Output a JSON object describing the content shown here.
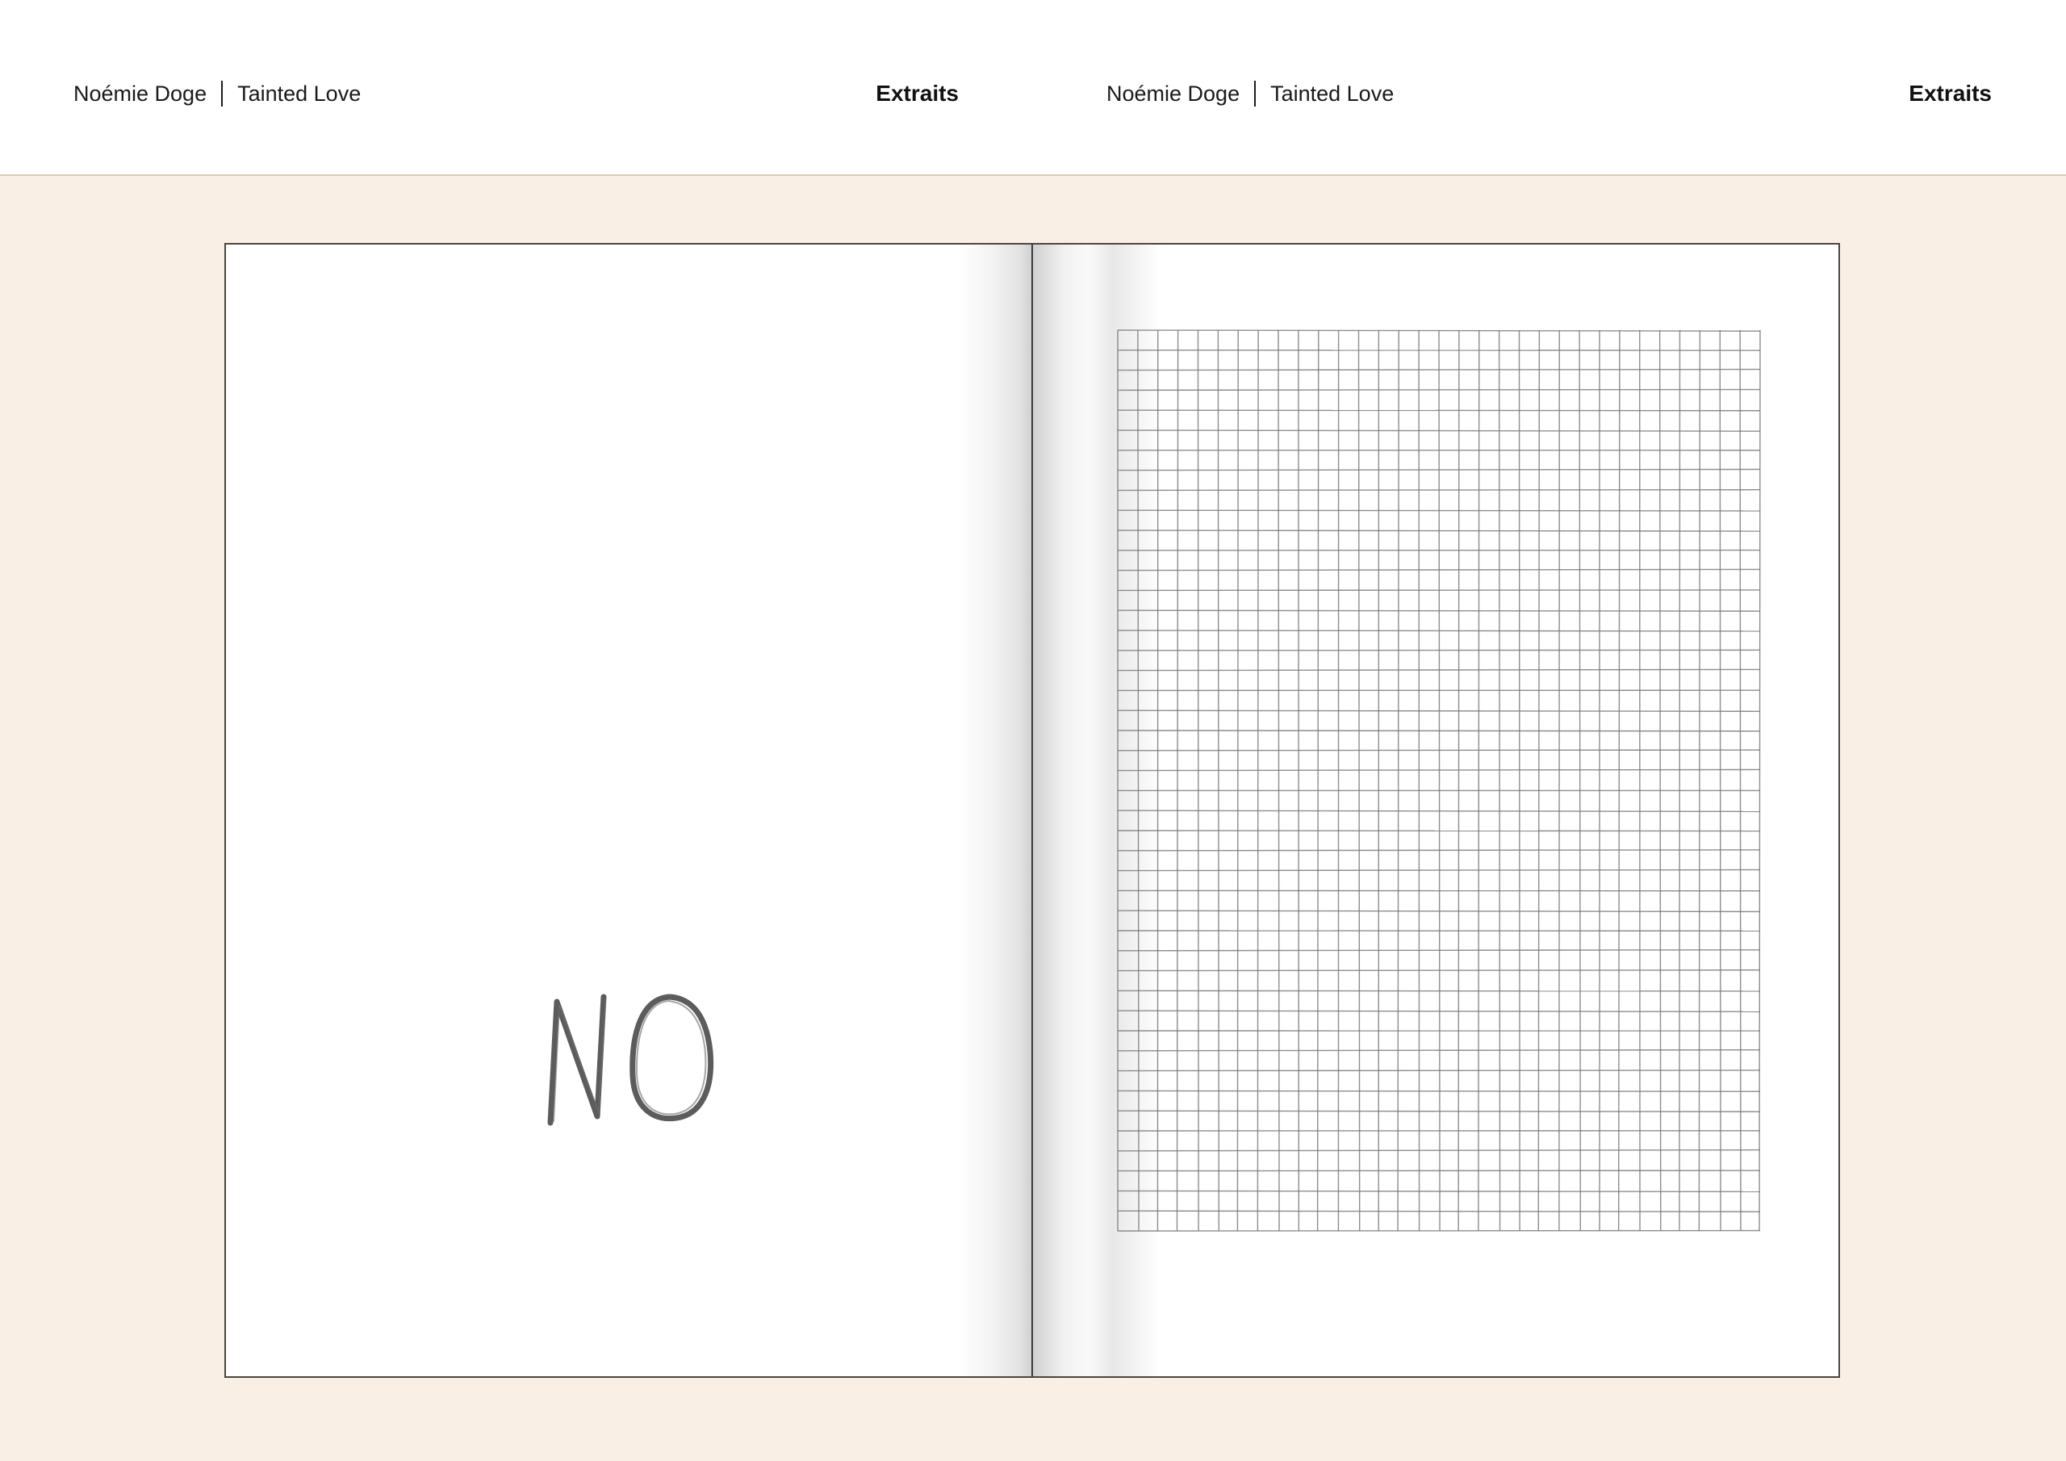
{
  "header_left": {
    "author": "Noémie Doge",
    "title": "Tainted Love",
    "section": "Extraits"
  },
  "header_right": {
    "author": "Noémie Doge",
    "title": "Tainted Love",
    "section": "Extraits"
  },
  "spread": {
    "left_page": {
      "drawing_text": "NO"
    },
    "right_page": {
      "grid_columns": 32,
      "grid_rows": 45
    }
  },
  "colors": {
    "background": "#f9efe5",
    "header": "#ffffff",
    "pencil": "#4a4a4a",
    "grid_line": "#7a7a7a"
  }
}
